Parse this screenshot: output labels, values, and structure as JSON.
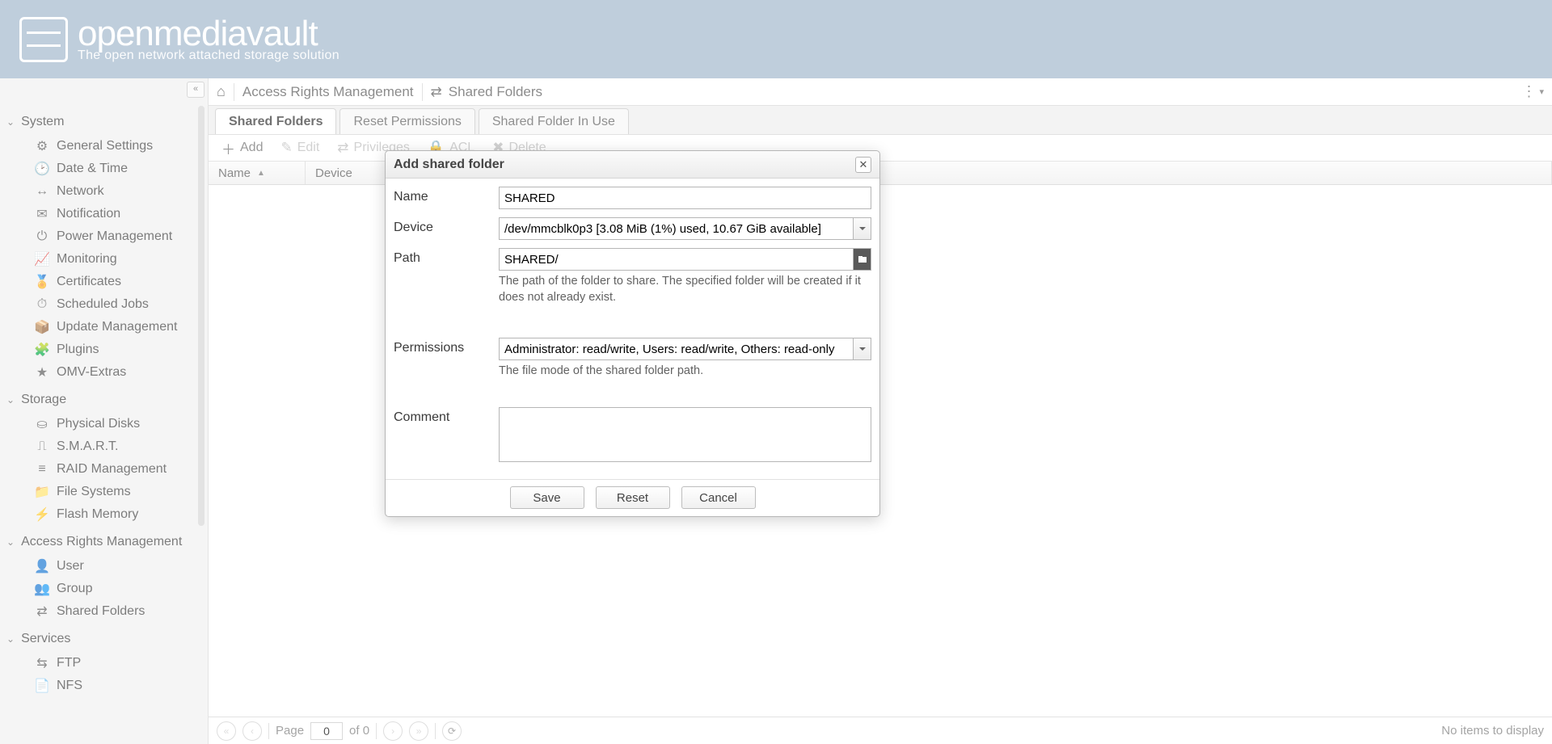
{
  "header": {
    "brand": "openmediavault",
    "tag": "The open network attached storage solution"
  },
  "breadcrumb": {
    "group": "Access Rights Management",
    "page": "Shared Folders"
  },
  "tabs": {
    "shared": "Shared Folders",
    "reset": "Reset Permissions",
    "inuse": "Shared Folder In Use"
  },
  "toolbar": {
    "add": "Add",
    "edit": "Edit",
    "privileges": "Privileges",
    "acl": "ACL",
    "delete": "Delete"
  },
  "grid": {
    "col_name": "Name",
    "col_device": "Device"
  },
  "pager": {
    "page_label": "Page",
    "page_value": "0",
    "of_label": "of 0",
    "status": "No items to display"
  },
  "sidebar": {
    "system": {
      "label": "System",
      "general": "General Settings",
      "datetime": "Date & Time",
      "network": "Network",
      "notification": "Notification",
      "power": "Power Management",
      "monitoring": "Monitoring",
      "certs": "Certificates",
      "scheduled": "Scheduled Jobs",
      "updates": "Update Management",
      "plugins": "Plugins",
      "omv": "OMV-Extras"
    },
    "storage": {
      "label": "Storage",
      "disks": "Physical Disks",
      "smart": "S.M.A.R.T.",
      "raid": "RAID Management",
      "fs": "File Systems",
      "flash": "Flash Memory"
    },
    "arm": {
      "label": "Access Rights Management",
      "user": "User",
      "group": "Group",
      "shared": "Shared Folders"
    },
    "services": {
      "label": "Services",
      "ftp": "FTP",
      "nfs": "NFS"
    }
  },
  "modal": {
    "title": "Add shared folder",
    "name_label": "Name",
    "name_value": "SHARED",
    "device_label": "Device",
    "device_value": "/dev/mmcblk0p3 [3.08 MiB (1%) used, 10.67 GiB available]",
    "path_label": "Path",
    "path_value": "SHARED/",
    "path_help": "The path of the folder to share. The specified folder will be created if it does not already exist.",
    "perm_label": "Permissions",
    "perm_value": "Administrator: read/write, Users: read/write, Others: read-only",
    "perm_help": "The file mode of the shared folder path.",
    "comment_label": "Comment",
    "comment_value": "",
    "save": "Save",
    "reset": "Reset",
    "cancel": "Cancel"
  }
}
